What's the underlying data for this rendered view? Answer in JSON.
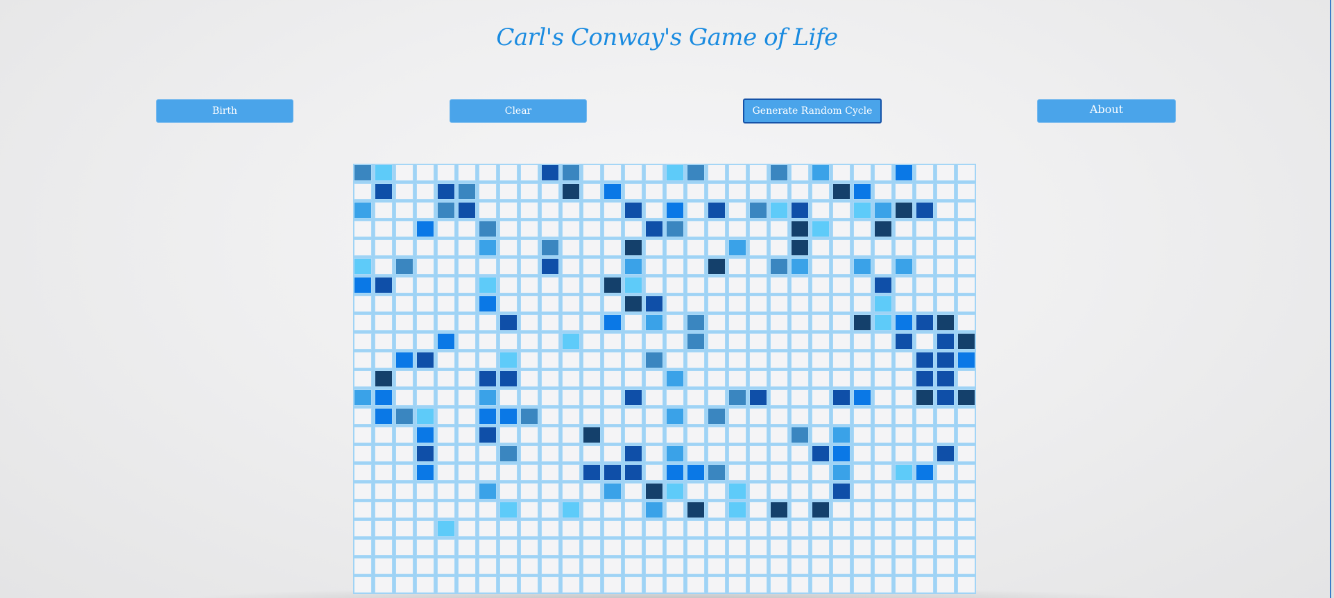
{
  "title": "Carl's Conway's Game of Life",
  "buttons": {
    "birth": "Birth",
    "clear": "Clear",
    "random": "Generate Random Cycle",
    "about": "About"
  },
  "colors": {
    "title": "#1a8be0",
    "button": "#4aa4ea",
    "dead_cell": "#f4f4f6",
    "cell_border": "#a9d8f7",
    "palette": [
      "",
      "#3a86c0",
      "#5ecbf9",
      "#0f4fa8",
      "#0a78e6",
      "#14406b",
      "#3aa2e8"
    ]
  },
  "board": {
    "rows": 23,
    "cols": 30,
    "cells": [
      "120000000310000210001060004000",
      "030031000050400000000005400000",
      "600013000000030403012300265300",
      "000400100000003100000520050000",
      "000000600100050000600500000000",
      "201000000300060005001600606000",
      "430000200000520000000000030000",
      "000000400000053000000000020000",
      "000000030000406010000000524350",
      "000040000020000010000000003035",
      "004300020000001000000000000334",
      "050000330000000600000000000330",
      "640000600000030000130003400535",
      "041200441000000601000000000000",
      "000400300005000000000106000000",
      "000300010000030600000034000030",
      "000400000003330441000006002400",
      "000000600000605200200003000000",
      "000000020020006050205050000000",
      "000020000000000000000000000000",
      "000000000000000000000000000000",
      "000000000000000000000000000000",
      "000000000000000000000000000000"
    ]
  }
}
